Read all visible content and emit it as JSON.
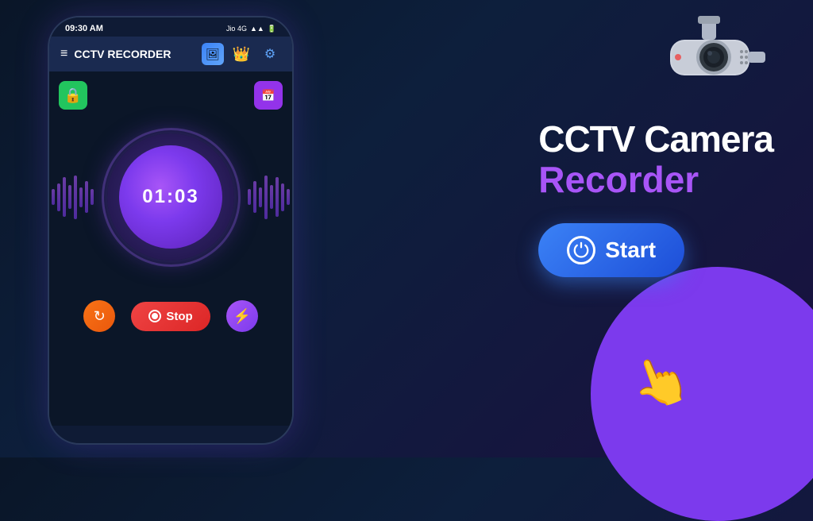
{
  "app": {
    "title": "CCTV RECORDER",
    "status_bar": {
      "time": "09:30 AM",
      "carrier": "Jio 4G"
    }
  },
  "phone": {
    "timer": "01:03",
    "stop_label": "Stop",
    "start_label": "Start"
  },
  "headline": {
    "line1": "CCTV Camera",
    "line2": "Recorder"
  },
  "buttons": {
    "start": "Start",
    "stop": "Stop"
  },
  "icons": {
    "hamburger": "≡",
    "gallery": "🖼",
    "crown": "👑",
    "settings": "⚙",
    "lock": "🔒",
    "schedule": "📅",
    "refresh": "↻",
    "lightning": "⚡",
    "power": "⏻"
  }
}
